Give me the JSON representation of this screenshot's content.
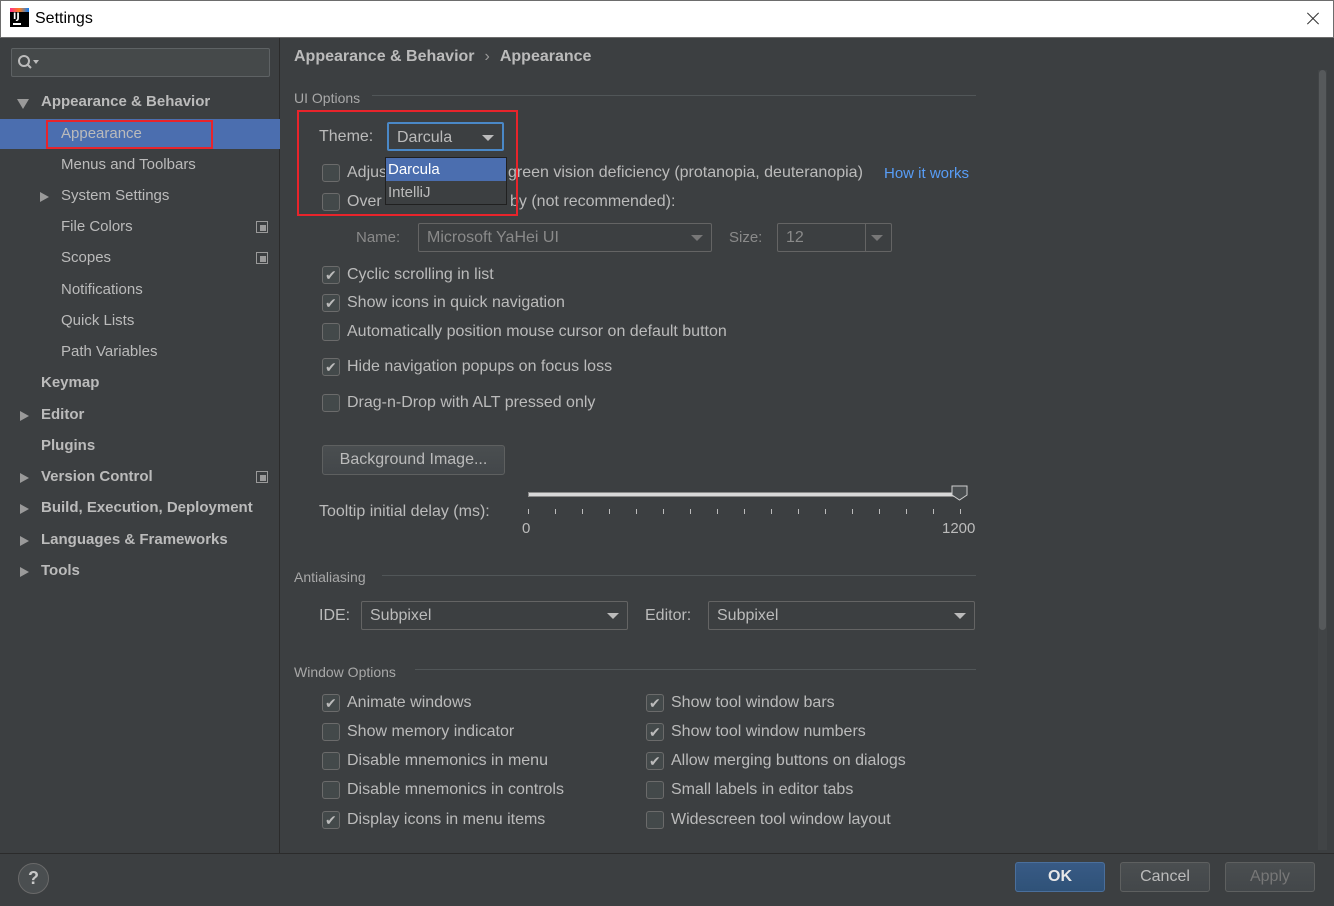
{
  "window": {
    "title": "Settings"
  },
  "sidebar": {
    "search_placeholder": "",
    "items": [
      {
        "label": "Appearance & Behavior"
      },
      {
        "label": "Appearance"
      },
      {
        "label": "Menus and Toolbars"
      },
      {
        "label": "System Settings"
      },
      {
        "label": "File Colors"
      },
      {
        "label": "Scopes"
      },
      {
        "label": "Notifications"
      },
      {
        "label": "Quick Lists"
      },
      {
        "label": "Path Variables"
      },
      {
        "label": "Keymap"
      },
      {
        "label": "Editor"
      },
      {
        "label": "Plugins"
      },
      {
        "label": "Version Control"
      },
      {
        "label": "Build, Execution, Deployment"
      },
      {
        "label": "Languages & Frameworks"
      },
      {
        "label": "Tools"
      }
    ]
  },
  "breadcrumb": {
    "parent": "Appearance & Behavior",
    "separator": "›",
    "current": "Appearance"
  },
  "ui_options": {
    "section_title": "UI Options",
    "theme_label": "Theme:",
    "theme_value": "Darcula",
    "theme_options": [
      "Darcula",
      "IntelliJ"
    ],
    "adjust_colors": {
      "label_visible_start": "Adjus",
      "label_visible_end": "green vision deficiency (protanopia, deuteranopia)",
      "checked": false
    },
    "how_it_works": "How it works",
    "override_fonts": {
      "label_start": "Over",
      "label_end": "by (not recommended):",
      "checked": false
    },
    "font_name_label": "Name:",
    "font_name_value": "Microsoft YaHei UI",
    "font_size_label": "Size:",
    "font_size_value": "12",
    "checkboxes": [
      {
        "label": "Cyclic scrolling in list",
        "checked": true
      },
      {
        "label": "Show icons in quick navigation",
        "checked": true
      },
      {
        "label": "Automatically position mouse cursor on default button",
        "checked": false
      },
      {
        "label": "Hide navigation popups on focus loss",
        "checked": true
      },
      {
        "label": "Drag-n-Drop with ALT pressed only",
        "checked": false
      }
    ],
    "background_image_button": "Background Image...",
    "tooltip_label": "Tooltip initial delay (ms):",
    "tooltip_min": "0",
    "tooltip_max": "1200",
    "tooltip_value_fraction": 1.0
  },
  "antialiasing": {
    "section_title": "Antialiasing",
    "ide_label": "IDE:",
    "ide_value": "Subpixel",
    "editor_label": "Editor:",
    "editor_value": "Subpixel"
  },
  "window_options": {
    "section_title": "Window Options",
    "left": [
      {
        "label": "Animate windows",
        "checked": true
      },
      {
        "label": "Show memory indicator",
        "checked": false
      },
      {
        "label": "Disable mnemonics in menu",
        "checked": false
      },
      {
        "label": "Disable mnemonics in controls",
        "checked": false
      },
      {
        "label": "Display icons in menu items",
        "checked": true
      }
    ],
    "right": [
      {
        "label": "Show tool window bars",
        "checked": true
      },
      {
        "label": "Show tool window numbers",
        "checked": true
      },
      {
        "label": "Allow merging buttons on dialogs",
        "checked": true
      },
      {
        "label": "Small labels in editor tabs",
        "checked": false
      },
      {
        "label": "Widescreen tool window layout",
        "checked": false
      }
    ]
  },
  "footer": {
    "help": "?",
    "ok": "OK",
    "cancel": "Cancel",
    "apply": "Apply"
  },
  "colors": {
    "background": "#3c3f41",
    "selection": "#4b6eaf",
    "link": "#589df6",
    "highlight_box": "#e8242b"
  }
}
